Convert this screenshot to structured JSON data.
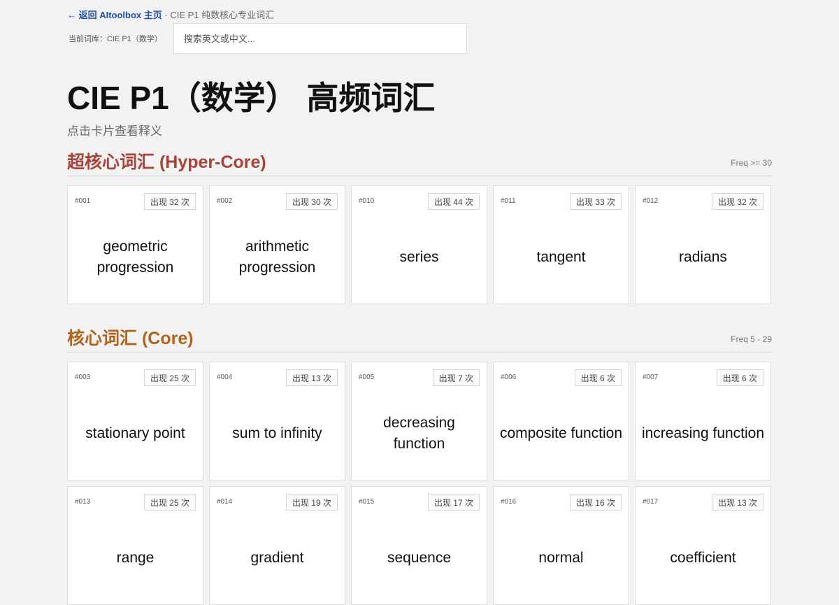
{
  "nav": {
    "back_label": "← 返回 AItoolbox 主页",
    "separator": "·",
    "current_page": "CIE P1 纯数核心专业词汇"
  },
  "library": {
    "label": "当前词库：CIE P1（数学）",
    "search_placeholder": "搜索英文或中文..."
  },
  "header": {
    "title": "CIE P1（数学） 高频词汇",
    "subtitle": "点击卡片查看释义"
  },
  "colors": {
    "hyper_core": "#a8443c",
    "core": "#b0641e",
    "link": "#1f4fa8"
  },
  "sections": [
    {
      "title": "超核心词汇 (Hyper-Core)",
      "freq": "Freq >= 30",
      "cards": [
        {
          "id": "#001",
          "count": "出现 32 次",
          "word": "geometric progression"
        },
        {
          "id": "#002",
          "count": "出现 30 次",
          "word": "arithmetic progression"
        },
        {
          "id": "#010",
          "count": "出现 44 次",
          "word": "series"
        },
        {
          "id": "#011",
          "count": "出现 33 次",
          "word": "tangent"
        },
        {
          "id": "#012",
          "count": "出现 32 次",
          "word": "radians"
        }
      ]
    },
    {
      "title": "核心词汇 (Core)",
      "freq": "Freq 5 - 29",
      "cards": [
        {
          "id": "#003",
          "count": "出现 25 次",
          "word": "stationary point"
        },
        {
          "id": "#004",
          "count": "出现 13 次",
          "word": "sum to infinity"
        },
        {
          "id": "#005",
          "count": "出现 7 次",
          "word": "decreasing function"
        },
        {
          "id": "#006",
          "count": "出现 6 次",
          "word": "composite function"
        },
        {
          "id": "#007",
          "count": "出现 6 次",
          "word": "increasing function"
        },
        {
          "id": "#013",
          "count": "出现 25 次",
          "word": "range"
        },
        {
          "id": "#014",
          "count": "出现 19 次",
          "word": "gradient"
        },
        {
          "id": "#015",
          "count": "出现 17 次",
          "word": "sequence"
        },
        {
          "id": "#016",
          "count": "出现 16 次",
          "word": "normal"
        },
        {
          "id": "#017",
          "count": "出现 13 次",
          "word": "coefficient"
        }
      ]
    }
  ]
}
